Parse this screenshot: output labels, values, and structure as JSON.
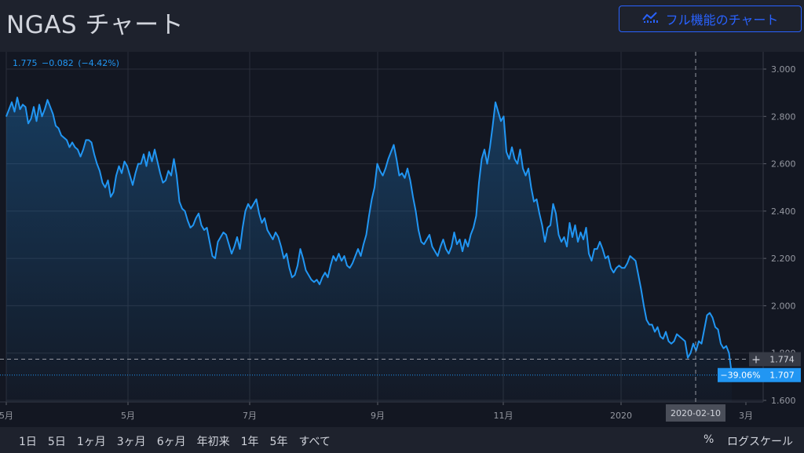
{
  "header": {
    "title": "NGAS チャート",
    "full_chart_button": "フル機能のチャート",
    "full_chart_icon": "chart-line-icon"
  },
  "legend": {
    "last": "1.775",
    "change": "−0.082",
    "change_pct": "(−4.42%)"
  },
  "bottom_bar": {
    "ranges": [
      "1日",
      "5日",
      "1ヶ月",
      "3ヶ月",
      "6ヶ月",
      "年初来",
      "1年",
      "5年",
      "すべて"
    ],
    "percent_label": "%",
    "log_label": "ログスケール"
  },
  "colors": {
    "line": "#2196f3",
    "background": "#131722",
    "grid": "#2a2e39",
    "text": "#d1d4dc"
  },
  "chart_data": {
    "type": "area",
    "ylim": [
      1.6,
      3.0
    ],
    "yticks": [
      "1.600",
      "1.800",
      "2.000",
      "2.200",
      "2.400",
      "2.600",
      "2.800",
      "3.000"
    ],
    "x_axis_labels": [
      "5月",
      "5月",
      "7月",
      "9月",
      "11月",
      "2020",
      "3月"
    ],
    "crosshair_date": "2020-02-10",
    "crosshair_value": "1.774",
    "last_value": "1.707",
    "last_change_pct": "−39.06%",
    "series": [
      {
        "values": [
          2.8,
          2.83,
          2.86,
          2.82,
          2.88,
          2.83,
          2.85,
          2.84,
          2.77,
          2.79,
          2.84,
          2.78,
          2.85,
          2.8,
          2.83,
          2.87,
          2.84,
          2.81,
          2.76,
          2.75,
          2.72,
          2.71,
          2.7,
          2.67,
          2.69,
          2.67,
          2.66,
          2.63,
          2.66,
          2.7,
          2.7,
          2.69,
          2.64,
          2.6,
          2.57,
          2.52,
          2.5,
          2.53,
          2.46,
          2.48,
          2.55,
          2.59,
          2.56,
          2.61,
          2.59,
          2.55,
          2.51,
          2.56,
          2.6,
          2.6,
          2.64,
          2.59,
          2.65,
          2.61,
          2.66,
          2.61,
          2.56,
          2.52,
          2.53,
          2.57,
          2.55,
          2.62,
          2.55,
          2.44,
          2.41,
          2.4,
          2.36,
          2.33,
          2.34,
          2.37,
          2.39,
          2.34,
          2.32,
          2.33,
          2.27,
          2.21,
          2.2,
          2.27,
          2.29,
          2.31,
          2.3,
          2.26,
          2.22,
          2.25,
          2.29,
          2.24,
          2.33,
          2.4,
          2.43,
          2.41,
          2.43,
          2.45,
          2.39,
          2.35,
          2.37,
          2.32,
          2.3,
          2.28,
          2.31,
          2.29,
          2.25,
          2.2,
          2.22,
          2.16,
          2.12,
          2.13,
          2.17,
          2.24,
          2.2,
          2.15,
          2.13,
          2.11,
          2.1,
          2.11,
          2.09,
          2.12,
          2.14,
          2.12,
          2.17,
          2.21,
          2.19,
          2.22,
          2.19,
          2.21,
          2.17,
          2.16,
          2.18,
          2.21,
          2.24,
          2.21,
          2.26,
          2.3,
          2.38,
          2.45,
          2.5,
          2.6,
          2.57,
          2.55,
          2.58,
          2.62,
          2.65,
          2.68,
          2.62,
          2.55,
          2.56,
          2.54,
          2.58,
          2.53,
          2.46,
          2.4,
          2.32,
          2.27,
          2.26,
          2.28,
          2.3,
          2.25,
          2.23,
          2.21,
          2.25,
          2.28,
          2.24,
          2.22,
          2.25,
          2.31,
          2.26,
          2.28,
          2.23,
          2.28,
          2.25,
          2.3,
          2.33,
          2.38,
          2.52,
          2.62,
          2.66,
          2.6,
          2.67,
          2.76,
          2.86,
          2.82,
          2.78,
          2.8,
          2.65,
          2.62,
          2.67,
          2.62,
          2.6,
          2.66,
          2.58,
          2.55,
          2.58,
          2.5,
          2.44,
          2.45,
          2.39,
          2.34,
          2.27,
          2.33,
          2.34,
          2.43,
          2.39,
          2.3,
          2.27,
          2.29,
          2.25,
          2.35,
          2.29,
          2.34,
          2.27,
          2.31,
          2.28,
          2.33,
          2.22,
          2.19,
          2.24,
          2.24,
          2.27,
          2.24,
          2.2,
          2.21,
          2.16,
          2.14,
          2.16,
          2.17,
          2.16,
          2.16,
          2.18,
          2.21,
          2.2,
          2.19,
          2.13,
          2.07,
          2.0,
          1.94,
          1.92,
          1.92,
          1.89,
          1.91,
          1.87,
          1.86,
          1.89,
          1.85,
          1.84,
          1.85,
          1.88,
          1.87,
          1.86,
          1.85,
          1.78,
          1.8,
          1.84,
          1.81,
          1.85,
          1.84,
          1.9,
          1.96,
          1.97,
          1.95,
          1.91,
          1.9,
          1.84,
          1.82,
          1.83,
          1.8,
          1.71
        ]
      }
    ]
  }
}
